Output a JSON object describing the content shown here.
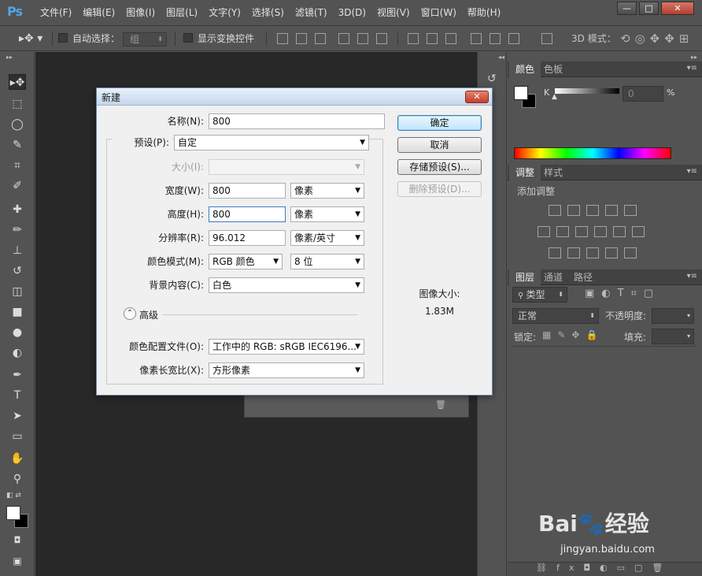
{
  "app": {
    "logo": "Ps"
  },
  "menu": [
    "文件(F)",
    "编辑(E)",
    "图像(I)",
    "图层(L)",
    "文字(Y)",
    "选择(S)",
    "滤镜(T)",
    "3D(D)",
    "视图(V)",
    "窗口(W)",
    "帮助(H)"
  ],
  "window_controls": {
    "minimize": "—",
    "maximize": "□",
    "close": "✕"
  },
  "options_bar": {
    "auto_select_label": "自动选择：",
    "auto_select_value": "组",
    "show_transform_label": "显示变换控件",
    "mode_3d_label": "3D 模式："
  },
  "tools": [
    "move",
    "marquee",
    "lasso",
    "quick-select",
    "crop",
    "eyedropper",
    "healing",
    "brush",
    "stamp",
    "history-brush",
    "eraser",
    "gradient",
    "blur",
    "dodge",
    "pen",
    "type",
    "path-select",
    "shape",
    "hand",
    "zoom"
  ],
  "tool_glyphs": [
    "▸✥",
    "⬚",
    "◯",
    "✎",
    "⌗",
    "✐",
    "✚",
    "✏",
    "⊥",
    "↺",
    "◫",
    "■",
    "●",
    "◐",
    "✒",
    "T",
    "➤",
    "▭",
    "✋",
    "⚲"
  ],
  "color_panel": {
    "tabs": [
      "颜色",
      "色板"
    ],
    "channel_label": "K",
    "channel_value": "0",
    "unit": "%"
  },
  "adjust_panel": {
    "tabs": [
      "调整",
      "样式"
    ],
    "title": "添加调整"
  },
  "layers_panel": {
    "tabs": [
      "图层",
      "通道",
      "路径"
    ],
    "filter_label": "类型",
    "blend_mode": "正常",
    "opacity_label": "不透明度:",
    "lock_label": "锁定:",
    "fill_label": "填充:"
  },
  "dialog": {
    "title": "新建",
    "close_glyph": "✕",
    "fields": {
      "name_label": "名称(N):",
      "name_value": "800",
      "preset_label": "预设(P):",
      "preset_value": "自定",
      "size_label": "大小(I):",
      "size_value": "",
      "width_label": "宽度(W):",
      "width_value": "800",
      "width_unit": "像素",
      "height_label": "高度(H):",
      "height_value": "800",
      "height_unit": "像素",
      "resolution_label": "分辨率(R):",
      "resolution_value": "96.012",
      "resolution_unit": "像素/英寸",
      "color_mode_label": "颜色模式(M):",
      "color_mode_value": "RGB 颜色",
      "bit_depth_value": "8 位",
      "bg_label": "背景内容(C):",
      "bg_value": "白色",
      "advanced_label": "高级",
      "profile_label": "颜色配置文件(O):",
      "profile_value": "工作中的 RGB: sRGB IEC6196...",
      "pixel_aspect_label": "像素长宽比(X):",
      "pixel_aspect_value": "方形像素"
    },
    "buttons": {
      "ok": "确定",
      "cancel": "取消",
      "save_preset": "存储预设(S)...",
      "delete_preset": "删除预设(D)..."
    },
    "image_size_label": "图像大小:",
    "image_size_value": "1.83M"
  },
  "watermark": {
    "logo": "Bai🐾经验",
    "url": "jingyan.baidu.com"
  }
}
